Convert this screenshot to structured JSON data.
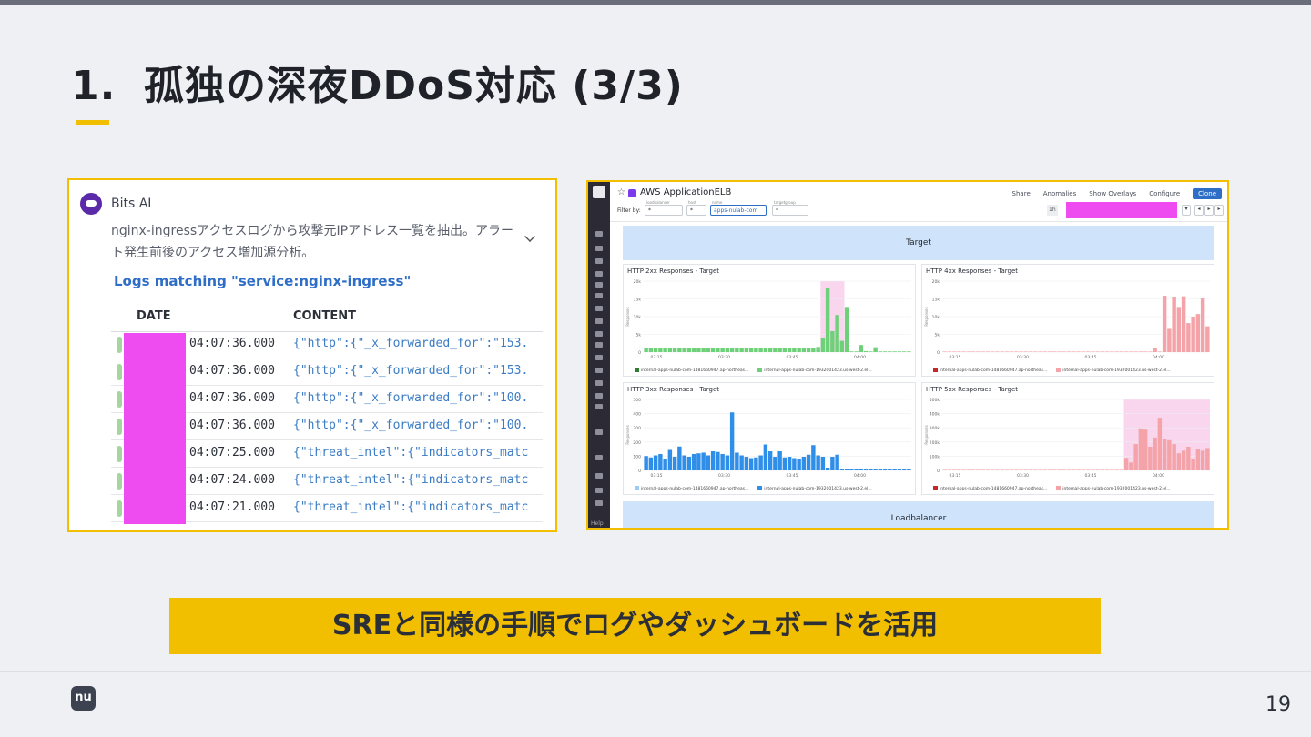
{
  "slide": {
    "title_num": "1.",
    "title": "孤独の深夜DDoS対応 (3/3)",
    "caption": "SREと同様の手順でログやダッシュボードを活用",
    "logo": "nu",
    "page_number": "19"
  },
  "bits_ai": {
    "name": "Bits AI",
    "prompt": "nginx-ingressアクセスログから攻撃元IPアドレス一覧を抽出。アラート発生前後のアクセス増加源分析。",
    "logs_title": "Logs matching \"service:nginx-ingress\"",
    "columns": [
      "DATE",
      "CONTENT"
    ],
    "rows": [
      {
        "date": "04:07:36.000",
        "content": "{\"http\":{\"_x_forwarded_for\":\"153."
      },
      {
        "date": "04:07:36.000",
        "content": "{\"http\":{\"_x_forwarded_for\":\"153."
      },
      {
        "date": "04:07:36.000",
        "content": "{\"http\":{\"_x_forwarded_for\":\"100."
      },
      {
        "date": "04:07:36.000",
        "content": "{\"http\":{\"_x_forwarded_for\":\"100."
      },
      {
        "date": "04:07:25.000",
        "content": "{\"threat_intel\":{\"indicators_matc"
      },
      {
        "date": "04:07:24.000",
        "content": "{\"threat_intel\":{\"indicators_matc"
      },
      {
        "date": "04:07:21.000",
        "content": "{\"threat_intel\":{\"indicators_matc"
      }
    ]
  },
  "dashboard": {
    "title": "AWS ApplicationELB",
    "actions": [
      "Share",
      "Anomalies",
      "Show Overlays",
      "Configure"
    ],
    "clone_label": "Clone",
    "filter_label": "Filter by:",
    "filters": [
      {
        "caption": "loadbalancer",
        "value": "*"
      },
      {
        "caption": "host",
        "value": "*"
      },
      {
        "caption": "name",
        "value": "apps-nulab-com"
      },
      {
        "caption": "targetgroup",
        "value": "*"
      }
    ],
    "time_label": "1h",
    "group_target": "Target",
    "group_loadbalancer": "Loadbalancer",
    "help_label": "Help",
    "colors": {
      "green": "#6fd07a",
      "blue": "#2f8fe8",
      "pink": "#f4a3a8",
      "highlight": "#f9d6ee"
    }
  },
  "chart_data": [
    {
      "type": "bar",
      "title": "HTTP 2xx Responses - Target",
      "ylabel": "Responses",
      "y_ticks": [
        "20k",
        "15k",
        "10k",
        "5k",
        "0"
      ],
      "x_ticks": [
        "03:15",
        "03:30",
        "03:45",
        "04:00"
      ],
      "ylim": [
        0,
        22000
      ],
      "color": "#6fd07a",
      "highlight": [
        37,
        41
      ],
      "values": [
        1200,
        1300,
        1250,
        1280,
        1300,
        1320,
        1280,
        1350,
        1300,
        1280,
        1320,
        1300,
        1310,
        1290,
        1300,
        1320,
        1280,
        1300,
        1310,
        1290,
        1300,
        1280,
        1300,
        1320,
        1300,
        1310,
        1290,
        1300,
        1280,
        1300,
        1310,
        1320,
        1300,
        1290,
        1300,
        1310,
        1600,
        4500,
        20000,
        6500,
        11500,
        3500,
        14000,
        200,
        200,
        2200,
        300,
        200,
        1500,
        200,
        200,
        200,
        200,
        200,
        200,
        200
      ],
      "legend": [
        "internal-apps-nulab-com-1481660947.ap-northeas...",
        "internal-apps-nulab-com-1932001423.us-west-2.el..."
      ],
      "legend_colors": [
        "#2e7d32",
        "#6fd07a"
      ]
    },
    {
      "type": "bar",
      "title": "HTTP 4xx Responses - Target",
      "ylabel": "Responses",
      "y_ticks": [
        "20k",
        "15k",
        "10k",
        "5k",
        "0"
      ],
      "x_ticks": [
        "03:15",
        "03:30",
        "03:45",
        "04:00"
      ],
      "ylim": [
        0,
        22000
      ],
      "color": "#f4a3a8",
      "values": [
        150,
        150,
        150,
        150,
        150,
        150,
        150,
        150,
        150,
        150,
        150,
        150,
        150,
        150,
        150,
        150,
        150,
        150,
        150,
        150,
        150,
        150,
        150,
        150,
        150,
        150,
        150,
        150,
        150,
        150,
        150,
        150,
        150,
        150,
        150,
        150,
        150,
        150,
        150,
        150,
        150,
        150,
        150,
        150,
        1200,
        150,
        17500,
        7200,
        17200,
        14000,
        17300,
        9000,
        11000,
        11800,
        16800,
        8000
      ],
      "legend": [
        "internal-apps-nulab-com-1481660947.ap-northeas...",
        "internal-apps-nulab-com-1932001423.us-west-2.el..."
      ],
      "legend_colors": [
        "#c62828",
        "#f4a3a8"
      ]
    },
    {
      "type": "bar",
      "title": "HTTP 3xx Responses - Target",
      "ylabel": "Responses",
      "y_ticks": [
        "500",
        "400",
        "300",
        "200",
        "100",
        "0"
      ],
      "x_ticks": [
        "03:15",
        "03:30",
        "03:45",
        "04:00"
      ],
      "ylim": [
        0,
        520
      ],
      "color": "#2f8fe8",
      "values": [
        105,
        95,
        110,
        120,
        85,
        150,
        100,
        175,
        110,
        100,
        120,
        125,
        130,
        110,
        140,
        135,
        120,
        110,
        425,
        130,
        110,
        100,
        90,
        95,
        110,
        190,
        140,
        100,
        140,
        95,
        100,
        90,
        80,
        100,
        115,
        185,
        110,
        100,
        20,
        100,
        115,
        10,
        10,
        10,
        10,
        10,
        10,
        10,
        10,
        10,
        10,
        10,
        10,
        10,
        10,
        10
      ],
      "legend": [
        "internal-apps-nulab-com-1481660947.ap-northeas...",
        "internal-apps-nulab-com-1932001423.us-west-2.el..."
      ],
      "legend_colors": [
        "#9ecbf5",
        "#2f8fe8"
      ]
    },
    {
      "type": "bar",
      "title": "HTTP 5xx Responses - Target",
      "ylabel": "Responses",
      "y_ticks": [
        "500k",
        "400k",
        "300k",
        "200k",
        "100k",
        "0"
      ],
      "x_ticks": [
        "03:15",
        "03:30",
        "03:45",
        "04:00"
      ],
      "ylim": [
        0,
        540000
      ],
      "color": "#f4a3a8",
      "highlight": [
        38,
        55
      ],
      "values": [
        0,
        0,
        0,
        0,
        0,
        0,
        0,
        0,
        0,
        0,
        0,
        0,
        0,
        0,
        0,
        0,
        0,
        0,
        0,
        0,
        0,
        0,
        0,
        0,
        0,
        0,
        0,
        0,
        0,
        0,
        0,
        0,
        0,
        0,
        0,
        0,
        0,
        0,
        95000,
        60000,
        200000,
        320000,
        310000,
        180000,
        250000,
        400000,
        240000,
        230000,
        200000,
        130000,
        150000,
        180000,
        90000,
        160000,
        150000,
        170000
      ],
      "legend": [
        "internal-apps-nulab-com-1481660947.ap-northeas...",
        "internal-apps-nulab-com-1932001423.us-west-2.el..."
      ],
      "legend_colors": [
        "#c62828",
        "#f4a3a8"
      ]
    }
  ]
}
